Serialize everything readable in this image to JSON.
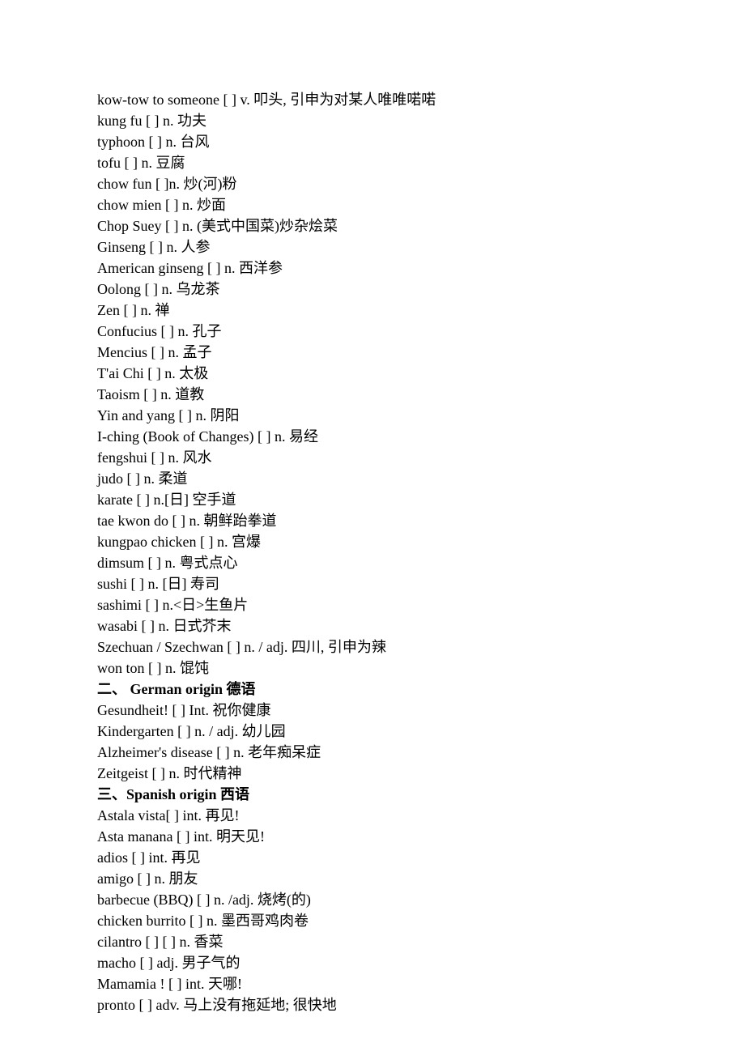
{
  "sections": [
    {
      "heading": null,
      "entries": [
        "kow-tow to someone [ ] v. 叩头, 引申为对某人唯唯喏喏",
        "kung fu [ ] n. 功夫",
        "typhoon [ ] n. 台风",
        "tofu [ ] n. 豆腐",
        "chow fun [ ]n. 炒(河)粉",
        "chow mien [ ] n. 炒面",
        "Chop Suey [ ] n. (美式中国菜)炒杂烩菜",
        "Ginseng [ ] n. 人参",
        "American ginseng [ ] n. 西洋参",
        "Oolong [ ] n. 乌龙茶",
        "Zen [ ] n. 禅",
        "Confucius [ ] n. 孔子",
        "Mencius [ ] n. 孟子",
        "T'ai Chi [ ] n. 太极",
        "Taoism [ ] n. 道教",
        "Yin and yang [ ] n. 阴阳",
        "I-ching (Book of Changes) [ ] n. 易经",
        "fengshui [ ] n. 风水",
        "judo [ ] n. 柔道",
        "karate [ ] n.[日] 空手道",
        "tae kwon do [ ] n. 朝鲜跆拳道",
        "kungpao chicken [ ] n. 宫爆",
        "dimsum [ ] n. 粤式点心",
        "sushi [ ] n. [日] 寿司",
        "sashimi [ ] n.<日>生鱼片",
        "wasabi [ ] n. 日式芥末",
        "Szechuan / Szechwan [ ] n. / adj. 四川, 引申为辣",
        "won ton [ ] n. 馄饨"
      ]
    },
    {
      "heading": "二、 German origin 德语",
      "entries": [
        "Gesundheit! [ ] Int. 祝你健康",
        "Kindergarten [ ] n. / adj. 幼儿园",
        "Alzheimer's disease [ ] n. 老年痴呆症",
        "Zeitgeist [ ] n. 时代精神"
      ]
    },
    {
      "heading": "三、Spanish origin 西语",
      "entries": [
        "Astala vista[ ] int. 再见!",
        "Asta manana [ ] int. 明天见!",
        "adios [ ] int. 再见",
        "amigo [ ] n. 朋友",
        "barbecue (BBQ) [ ] n. /adj. 烧烤(的)",
        "chicken burrito [ ] n. 墨西哥鸡肉卷",
        "cilantro [ ] [ ] n. 香菜",
        "macho [ ] adj. 男子气的",
        "Mamamia ! [ ] int. 天哪!",
        "pronto [ ] adv. 马上没有拖延地; 很快地"
      ]
    }
  ]
}
